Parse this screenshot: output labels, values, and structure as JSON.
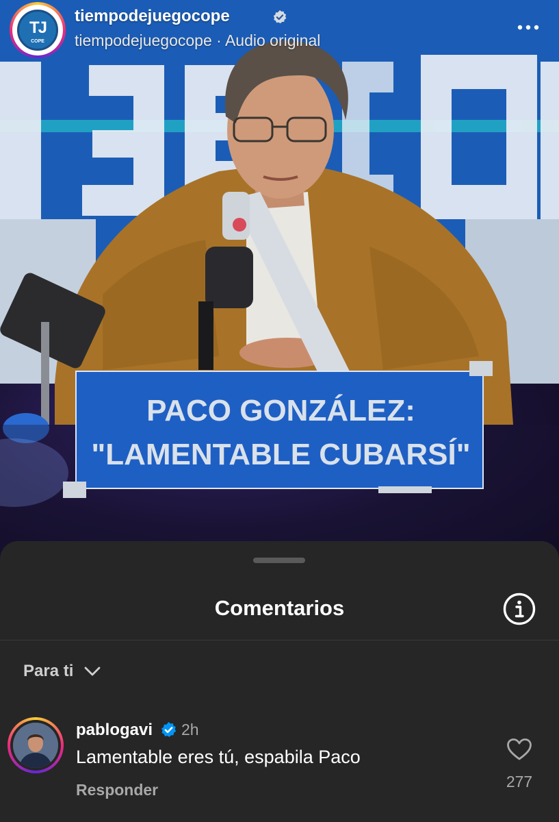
{
  "post": {
    "account": "tiempodejuegocope",
    "audio_account": "tiempodejuegocope",
    "audio_separator": "·",
    "audio_label": "Audio original",
    "logo_text": "TJ",
    "logo_sub": "COPE",
    "banner_line1": "PACO GONZÁLEZ:",
    "banner_line2": "\"LAMENTABLE CUBARSÍ\"",
    "more_icon": "more-horizontal-icon",
    "verified_icon": "verified-badge-icon"
  },
  "comments_sheet": {
    "title": "Comentarios",
    "info_icon": "info-icon",
    "filter_label": "Para ti",
    "filter_icon": "chevron-down-icon"
  },
  "comments": [
    {
      "username": "pablogavi",
      "verified": true,
      "time": "2h",
      "text": "Lamentable eres tú, espabila Paco",
      "reply_label": "Responder",
      "likes": "277",
      "like_icon": "heart-outline-icon"
    }
  ],
  "colors": {
    "sheet_bg": "#262626",
    "banner_bg": "#1e5fc4",
    "verified_blue": "#0095f6"
  }
}
